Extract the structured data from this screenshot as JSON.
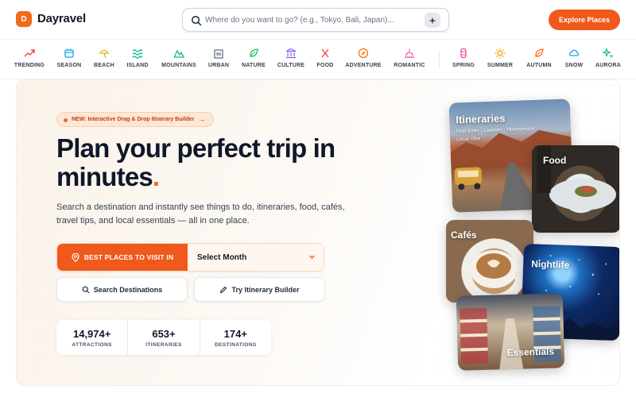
{
  "header": {
    "logo_letter": "D",
    "brand": "Dayravel",
    "search_placeholder": "Where do you want to go? (e.g., Tokyo, Bali, Japan)...",
    "explore_label": "Explore Places"
  },
  "categories": [
    {
      "label": "TRENDING",
      "icon": "trending-icon",
      "color": "#ef4444"
    },
    {
      "label": "SEASON",
      "icon": "calendar-icon",
      "color": "#0ea5e9"
    },
    {
      "label": "BEACH",
      "icon": "beach-umbrella-icon",
      "color": "#eab308"
    },
    {
      "label": "ISLAND",
      "icon": "waves-icon",
      "color": "#14b8a6"
    },
    {
      "label": "MOUNTAINS",
      "icon": "mountain-icon",
      "color": "#10b981"
    },
    {
      "label": "URBAN",
      "icon": "building-icon",
      "color": "#64748b"
    },
    {
      "label": "NATURE",
      "icon": "leaf-icon",
      "color": "#22c55e"
    },
    {
      "label": "CULTURE",
      "icon": "landmark-icon",
      "color": "#8b5cf6"
    },
    {
      "label": "FOOD",
      "icon": "utensils-icon",
      "color": "#ef4444"
    },
    {
      "label": "ADVENTURE",
      "icon": "compass-icon",
      "color": "#f97316"
    },
    {
      "label": "ROMANTIC",
      "icon": "sunset-icon",
      "color": "#ec4899"
    },
    {
      "label": "SPRING",
      "icon": "flower-icon",
      "color": "#ec4899"
    },
    {
      "label": "SUMMER",
      "icon": "sun-icon",
      "color": "#f59e0b"
    },
    {
      "label": "AUTUMN",
      "icon": "autumn-leaf-icon",
      "color": "#f97316"
    },
    {
      "label": "SNOW",
      "icon": "snow-cloud-icon",
      "color": "#0ea5e9"
    },
    {
      "label": "AURORA",
      "icon": "aurora-sparkles-icon",
      "color": "#10b981"
    }
  ],
  "hero": {
    "badge": "NEW: Interactive Drag & Drop Itinerary Builder",
    "headline": "Plan your perfect trip in minutes",
    "headline_dot": ".",
    "subtext": "Search a destination and instantly see things to do, itineraries, food, cafés, travel tips, and local essentials — all in one place.",
    "best_places_label": "BEST PLACES TO VISIT IN",
    "month_select": "Select Month",
    "search_destinations_label": "Search Destinations",
    "itinerary_builder_label": "Try Itinerary Builder",
    "stats": [
      {
        "value": "14,974+",
        "label": "ATTRACTIONS"
      },
      {
        "value": "653+",
        "label": "ITINERARIES"
      },
      {
        "value": "174+",
        "label": "DESTINATIONS"
      }
    ]
  },
  "collage": {
    "itineraries": {
      "title": "Itineraries",
      "subtitle_line1": "First timer · Layover · Honeymoon ·",
      "subtitle_line2": "Local Vibe"
    },
    "food": {
      "title": "Food"
    },
    "cafes": {
      "title": "Cafés"
    },
    "nightlife": {
      "title": "Nightlife"
    },
    "essentials": {
      "title": "Essentials"
    }
  },
  "colors": {
    "accent": "#f0591c",
    "text": "#0f172a"
  }
}
